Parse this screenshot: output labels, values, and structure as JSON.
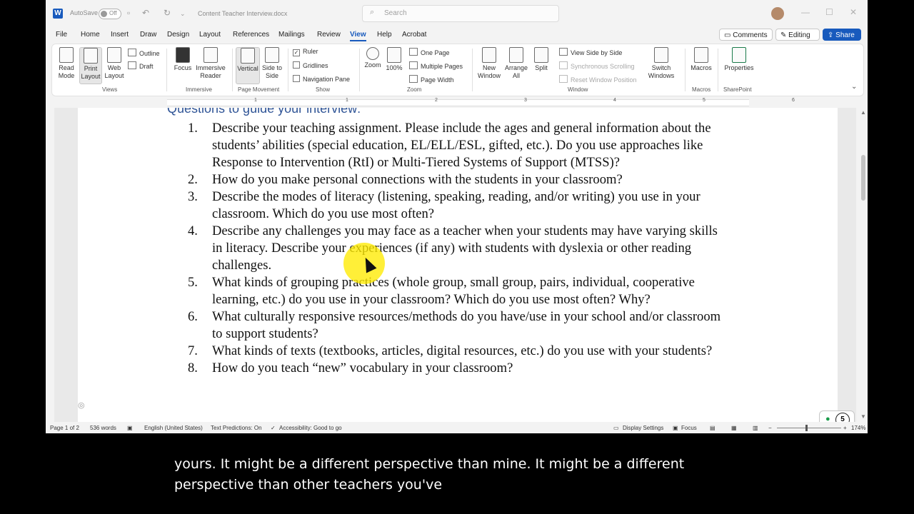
{
  "titlebar": {
    "autosave_label": "AutoSave",
    "autosave_state": "Off",
    "doc_title": "Content Teacher Interview.docx",
    "search_placeholder": "Search",
    "word_logo": "W"
  },
  "menu": {
    "tabs": [
      "File",
      "Home",
      "Insert",
      "Draw",
      "Design",
      "Layout",
      "References",
      "Mailings",
      "Review",
      "View",
      "Help",
      "Acrobat"
    ],
    "active_tab": "View",
    "comments_label": "Comments",
    "editing_label": "Editing",
    "share_label": "Share"
  },
  "ribbon": {
    "views": {
      "read_mode": "Read Mode",
      "print_layout": "Print Layout",
      "web_layout": "Web Layout",
      "outline": "Outline",
      "draft": "Draft",
      "group": "Views"
    },
    "immersive": {
      "focus": "Focus",
      "immersive_reader": "Immersive Reader",
      "group": "Immersive"
    },
    "page_movement": {
      "vertical": "Vertical",
      "side_to_side": "Side to Side",
      "group": "Page Movement"
    },
    "show": {
      "ruler": "Ruler",
      "gridlines": "Gridlines",
      "navigation_pane": "Navigation Pane",
      "group": "Show"
    },
    "zoom": {
      "zoom": "Zoom",
      "zoom100": "100%",
      "one_page": "One Page",
      "multiple_pages": "Multiple Pages",
      "page_width": "Page Width",
      "group": "Zoom"
    },
    "window": {
      "new_window": "New Window",
      "arrange_all": "Arrange All",
      "split": "Split",
      "view_side_by_side": "View Side by Side",
      "sync_scrolling": "Synchronous Scrolling",
      "reset_position": "Reset Window Position",
      "switch_windows": "Switch Windows",
      "group": "Window"
    },
    "macros": {
      "macros": "Macros",
      "group": "Macros"
    },
    "sharepoint": {
      "properties": "Properties",
      "group": "SharePoint"
    }
  },
  "ruler_numbers": [
    "1",
    "1",
    "2",
    "3",
    "4",
    "5",
    "6"
  ],
  "document": {
    "heading": "Questions to guide your interview:",
    "questions": [
      {
        "num": "1.",
        "text": "Describe your teaching assignment. Please include the ages and general information about the students’ abilities (special education, EL/ELL/ESL, gifted, etc.). Do you use approaches like Response to Intervention (RtI) or Multi-Tiered Systems of Support (MTSS)?"
      },
      {
        "num": "2.",
        "text": "How do you make personal connections with the students in your classroom?"
      },
      {
        "num": "3.",
        "text": "Describe the modes of literacy (listening, speaking, reading, and/or writing) you use in your classroom. Which do you use most often?"
      },
      {
        "num": "4.",
        "text": "Describe any challenges you may face as a teacher when your students may have varying skills in literacy. Describe your experiences (if any) with students with dyslexia or other reading challenges."
      },
      {
        "num": "5.",
        "text": "What kinds of grouping practices (whole group, small group, pairs, individual, cooperative learning, etc.) do you use in your classroom? Which do you use most often? Why?"
      },
      {
        "num": "6.",
        "text": "What culturally responsive resources/methods do you have/use in your school and/or classroom to support students?"
      },
      {
        "num": "7.",
        "text": "What kinds of texts (textbooks, articles, digital resources, etc.) do you use with your students?"
      },
      {
        "num": "8.",
        "text": "How do you teach “new” vocabulary in your classroom?"
      }
    ]
  },
  "badge_count": "5",
  "status": {
    "page": "Page 1 of 2",
    "words": "536 words",
    "language": "English (United States)",
    "predictions": "Text Predictions: On",
    "accessibility": "Accessibility: Good to go",
    "display_settings": "Display Settings",
    "focus": "Focus",
    "zoom": "174%"
  },
  "caption": {
    "line1": "yours. It might be a different perspective than mine. It might be a different",
    "line2": "perspective than other teachers you've"
  }
}
